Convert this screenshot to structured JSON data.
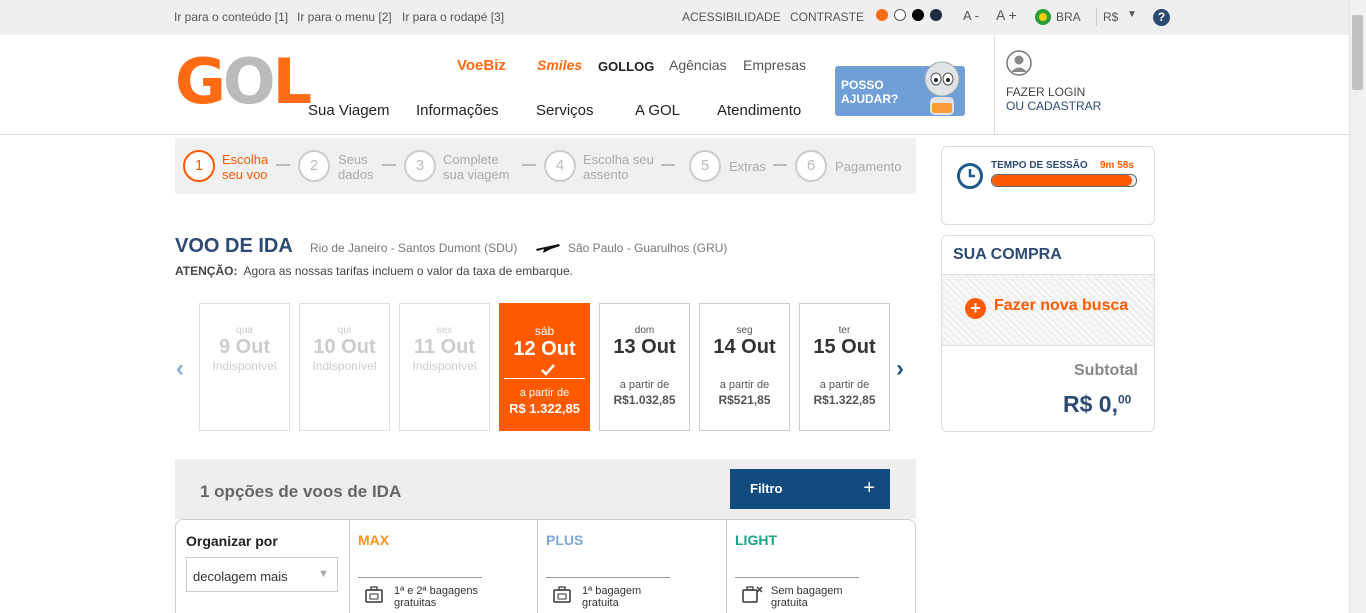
{
  "utility": {
    "skip_content": "Ir para o conteúdo [1]",
    "skip_menu": "Ir para o menu [2]",
    "skip_footer": "Ir para o rodapé [3]",
    "accessibility": "ACESSIBILIDADE",
    "contrast": "CONTRASTE",
    "font_decrease": "A -",
    "font_increase": "A +",
    "country": "BRA",
    "currency": "R$",
    "help": "?"
  },
  "header": {
    "logo_g": "G",
    "logo_o": "O",
    "logo_l": "L",
    "brands": {
      "voebiz": "VoeBiz",
      "smiles": "Smiles",
      "gollog": "GOLLOG"
    },
    "top_links": [
      "Agências",
      "Empresas"
    ],
    "nav": [
      "Sua Viagem",
      "Informações",
      "Serviços",
      "A GOL",
      "Atendimento"
    ],
    "help_line1": "POSSO",
    "help_line2": "AJUDAR?",
    "login_line1": "FAZER LOGIN",
    "login_line2": "OU CADASTRAR"
  },
  "steps": [
    {
      "num": "1",
      "l1": "Escolha",
      "l2": "seu voo"
    },
    {
      "num": "2",
      "l1": "Seus",
      "l2": "dados"
    },
    {
      "num": "3",
      "l1": "Complete",
      "l2": "sua viagem"
    },
    {
      "num": "4",
      "l1": "Escolha seu",
      "l2": "assento"
    },
    {
      "num": "5",
      "l1": "Extras",
      "l2": ""
    },
    {
      "num": "6",
      "l1": "Pagamento",
      "l2": ""
    }
  ],
  "session": {
    "label": "TEMPO DE SESSÃO",
    "time": "9m 58s",
    "remaining": 0.97
  },
  "purchase": {
    "title": "SUA COMPRA",
    "new_search": "Fazer nova busca",
    "subtotal_label": "Subtotal",
    "subtotal_main": "R$ 0,",
    "subtotal_cents": "00"
  },
  "flight": {
    "title": "VOO DE IDA",
    "origin": "Rio de Janeiro - Santos Dumont  (SDU)",
    "destination": "São Paulo - Guarulhos  (GRU)",
    "notice_label": "ATENÇÃO:",
    "notice": "Agora as nossas tarifas incluem o valor da taxa de embarque."
  },
  "dates": [
    {
      "wd": "qua",
      "dt": "9 Out",
      "lbl": "Indisponível",
      "price": "",
      "state": "dis"
    },
    {
      "wd": "qui",
      "dt": "10 Out",
      "lbl": "Indisponível",
      "price": "",
      "state": "dis"
    },
    {
      "wd": "sex",
      "dt": "11 Out",
      "lbl": "Indisponível",
      "price": "",
      "state": "dis"
    },
    {
      "wd": "sáb",
      "dt": "12 Out",
      "lbl": "a partir de",
      "price": "R$ 1.322,85",
      "state": "sel"
    },
    {
      "wd": "dom",
      "dt": "13 Out",
      "lbl": "a partir de",
      "price": "R$1.032,85",
      "state": ""
    },
    {
      "wd": "seg",
      "dt": "14 Out",
      "lbl": "a partir de",
      "price": "R$521,85",
      "state": ""
    },
    {
      "wd": "ter",
      "dt": "15 Out",
      "lbl": "a partir de",
      "price": "R$1.322,85",
      "state": ""
    }
  ],
  "options": {
    "count": "1 opções de voos de IDA",
    "filter": "Filtro",
    "sort_label": "Organizar por",
    "sort_value": "decolagem mais",
    "fares": [
      {
        "name": "MAX",
        "color": "#f7941d",
        "bag1": "1ª e 2ª bagagens",
        "bag2": "gratuitas"
      },
      {
        "name": "PLUS",
        "color": "#7fa6d8",
        "bag1": "1ª bagagem",
        "bag2": "gratuita"
      },
      {
        "name": "LIGHT",
        "color": "#17a589",
        "bag1": "Sem bagagem",
        "bag2": "gratuita"
      }
    ]
  }
}
